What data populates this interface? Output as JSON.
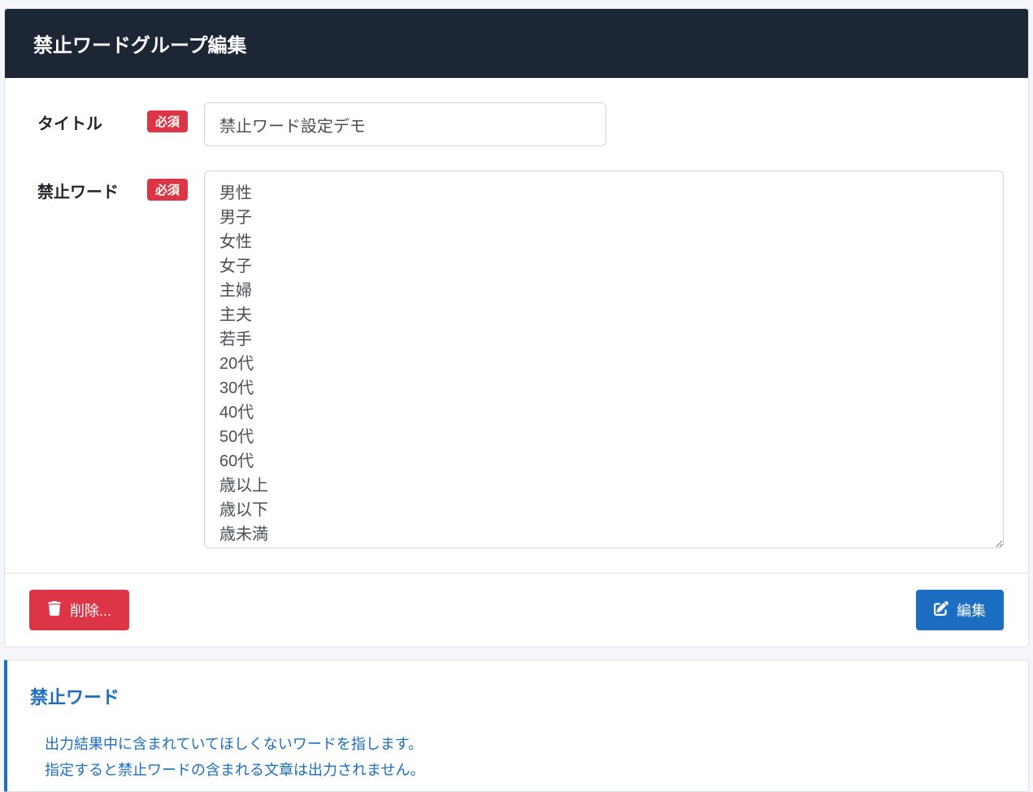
{
  "header": {
    "title": "禁止ワードグループ編集"
  },
  "form": {
    "title_label": "タイトル",
    "required_badge": "必須",
    "title_value": "禁止ワード設定デモ",
    "words_label": "禁止ワード",
    "words_value": "男性\n男子\n女性\n女子\n主婦\n主夫\n若手\n20代\n30代\n40代\n50代\n60代\n歳以上\n歳以下\n歳未満"
  },
  "buttons": {
    "delete_label": "削除...",
    "edit_label": "編集"
  },
  "info": {
    "title": "禁止ワード",
    "line1": "出力結果中に含まれていてほしくないワードを指します。",
    "line2": "指定すると禁止ワードの含まれる文章は出力されません。"
  }
}
